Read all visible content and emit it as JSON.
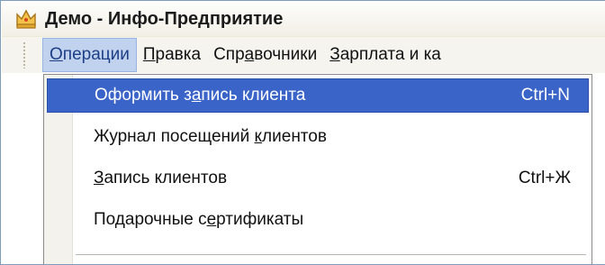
{
  "window": {
    "title": "Демо - Инфо-Предприятие"
  },
  "menubar": [
    {
      "pre": "",
      "acc": "О",
      "post": "перации"
    },
    {
      "pre": "",
      "acc": "П",
      "post": "равка"
    },
    {
      "pre": "Спр",
      "acc": "а",
      "post": "вочники"
    },
    {
      "pre": "",
      "acc": "З",
      "post": "арплата и ка"
    }
  ],
  "dropdown": [
    {
      "pre": "Оформить з",
      "acc": "а",
      "post": "пись клиента",
      "shortcut": "Ctrl+N"
    },
    {
      "pre": "Журнал посещений ",
      "acc": "к",
      "post": "лиентов",
      "shortcut": ""
    },
    {
      "pre": "",
      "acc": "З",
      "post": "апись клиентов",
      "shortcut": "Ctrl+Ж"
    },
    {
      "pre": "Подарочные с",
      "acc": "е",
      "post": "ртификаты",
      "shortcut": ""
    }
  ],
  "icons": {
    "app": "crown-icon"
  },
  "colors": {
    "highlight": "#3b64c9",
    "active_menu": "#c1d2ee"
  }
}
